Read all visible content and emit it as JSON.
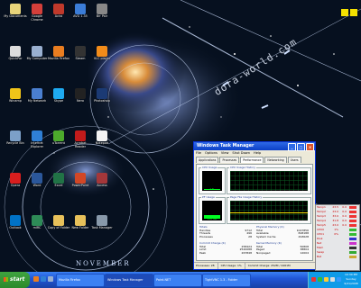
{
  "wallpaper": {
    "brand_text": "dora-world.com",
    "november": "NOVEMBER"
  },
  "desktop_icons": [
    {
      "label": "My Documents",
      "color": "#e8d47a"
    },
    {
      "label": "Google Chrome",
      "color": "#d43f3a"
    },
    {
      "label": "Avira",
      "color": "#c0392b"
    },
    {
      "label": "AVG 1.35",
      "color": "#3b7dd8"
    },
    {
      "label": "Brr Pair",
      "color": "#888888"
    },
    {
      "label": "QuickPar",
      "color": "#dddddd"
    },
    {
      "label": "My Computer",
      "color": "#9ab0d0"
    },
    {
      "label": "Mozilla Firefox",
      "color": "#e97d20"
    },
    {
      "label": "Steam",
      "color": "#333333"
    },
    {
      "label": "VLC player",
      "color": "#f28c1a"
    },
    {
      "label": "Winamp",
      "color": "#f0c419"
    },
    {
      "label": "My Network",
      "color": "#4a7fd0"
    },
    {
      "label": "Skype",
      "color": "#1eaaf1"
    },
    {
      "label": "Nero",
      "color": "#222222"
    },
    {
      "label": "Photoshop",
      "color": "#1b3a74"
    },
    {
      "label": "Recycle Bin",
      "color": "#7ca0c8"
    },
    {
      "label": "Internet Explorer",
      "color": "#2f7fd5"
    },
    {
      "label": "uTorrent",
      "color": "#4caa2c"
    },
    {
      "label": "Acrobat Reader",
      "color": "#c21b1b"
    },
    {
      "label": "Notepad",
      "color": "#f2f2f2"
    },
    {
      "label": "Opera",
      "color": "#d81e1e"
    },
    {
      "label": "Word",
      "color": "#2b579a"
    },
    {
      "label": "Excel",
      "color": "#217346"
    },
    {
      "label": "PowerPoint",
      "color": "#d24726"
    },
    {
      "label": "Access",
      "color": "#a4373a"
    },
    {
      "label": "Outlook",
      "color": "#0072c6"
    },
    {
      "label": "mIRC",
      "color": "#2e8b57"
    },
    {
      "label": "Copy of Folder",
      "color": "#e8c15a"
    },
    {
      "label": "New Folder",
      "color": "#e8c15a"
    },
    {
      "label": "Task Manager",
      "color": "#8899aa"
    }
  ],
  "task_manager": {
    "title": "Windows Task Manager",
    "menu": [
      "File",
      "Options",
      "View",
      "Shut Down",
      "Help"
    ],
    "tabs": [
      "Applications",
      "Processes",
      "Performance",
      "Networking",
      "Users"
    ],
    "active_tab": "Performance",
    "cpu_usage_label": "CPU Usage",
    "cpu_history_label": "CPU Usage History",
    "pf_usage_label": "PF Usage",
    "pf_history_label": "Page File Usage History",
    "cpu_usage_text": "1 %",
    "pf_usage_text": "252 MB",
    "cpu_usage_level": 0.01,
    "pf_usage_level": 0.25,
    "totals": {
      "header": "Totals",
      "rows": [
        [
          "Handles",
          "9712"
        ],
        [
          "Threads",
          "496"
        ],
        [
          "Processes",
          "28"
        ]
      ]
    },
    "physical": {
      "header": "Physical Memory (K)",
      "rows": [
        [
          "Total",
          "1047856"
        ],
        [
          "Available",
          "828188"
        ],
        [
          "System Cache",
          "293628"
        ]
      ]
    },
    "commit": {
      "header": "Commit Charge (K)",
      "rows": [
        [
          "Total",
          "258424"
        ],
        [
          "Limit",
          "2520088"
        ],
        [
          "Peak",
          "267848"
        ]
      ]
    },
    "kernel": {
      "header": "Kernel Memory (K)",
      "rows": [
        [
          "Total",
          "50808"
        ],
        [
          "Paged",
          "38804"
        ],
        [
          "Nonpaged",
          "12004"
        ]
      ]
    },
    "status": {
      "processes": "Processes: 28",
      "cpu": "CPU Usage: 1%",
      "commit": "Commit Charge: 252M / 2461M"
    }
  },
  "gadget": {
    "rows": [
      {
        "name": "Temp1",
        "c": "23.5",
        "f": "0.0",
        "color": "#e33"
      },
      {
        "name": "Temp2",
        "c": "24.0",
        "f": "0.0",
        "color": "#e33"
      },
      {
        "name": "Temp3",
        "c": "33.0",
        "f": "0.0",
        "color": "#e33"
      },
      {
        "name": "Temp4",
        "c": "31.8",
        "f": "0.0",
        "color": "#e33"
      },
      {
        "name": "Temp5",
        "c": "23.0",
        "f": "0.0",
        "color": "#e33"
      },
      {
        "name": "CPU0",
        "c": "1%",
        "f": "",
        "color": "#3b3"
      },
      {
        "name": "CPU1",
        "c": "0%",
        "f": "",
        "color": "#3b3"
      },
      {
        "name": "Disk",
        "c": "",
        "f": "",
        "color": "#33c"
      },
      {
        "name": "Net",
        "c": "",
        "f": "",
        "color": "#c3c"
      },
      {
        "name": "Mem",
        "c": "",
        "f": "",
        "color": "#333"
      },
      {
        "name": "Swap",
        "c": "",
        "f": "",
        "color": "#3a3"
      },
      {
        "name": "Bat",
        "c": "",
        "f": "",
        "color": "#ca3"
      }
    ]
  },
  "taskbar": {
    "start_label": "start",
    "buttons": [
      {
        "label": "Mozilla Firefox",
        "active": false
      },
      {
        "label": "Windows Task Manager",
        "active": true
      },
      {
        "label": "Paint.NET",
        "active": false
      },
      {
        "label": "TightVNC 1.3 - Folder",
        "active": false
      }
    ],
    "clock_time": "10:30 PM",
    "clock_day": "Sunday",
    "clock_date": "9/21/2008"
  }
}
